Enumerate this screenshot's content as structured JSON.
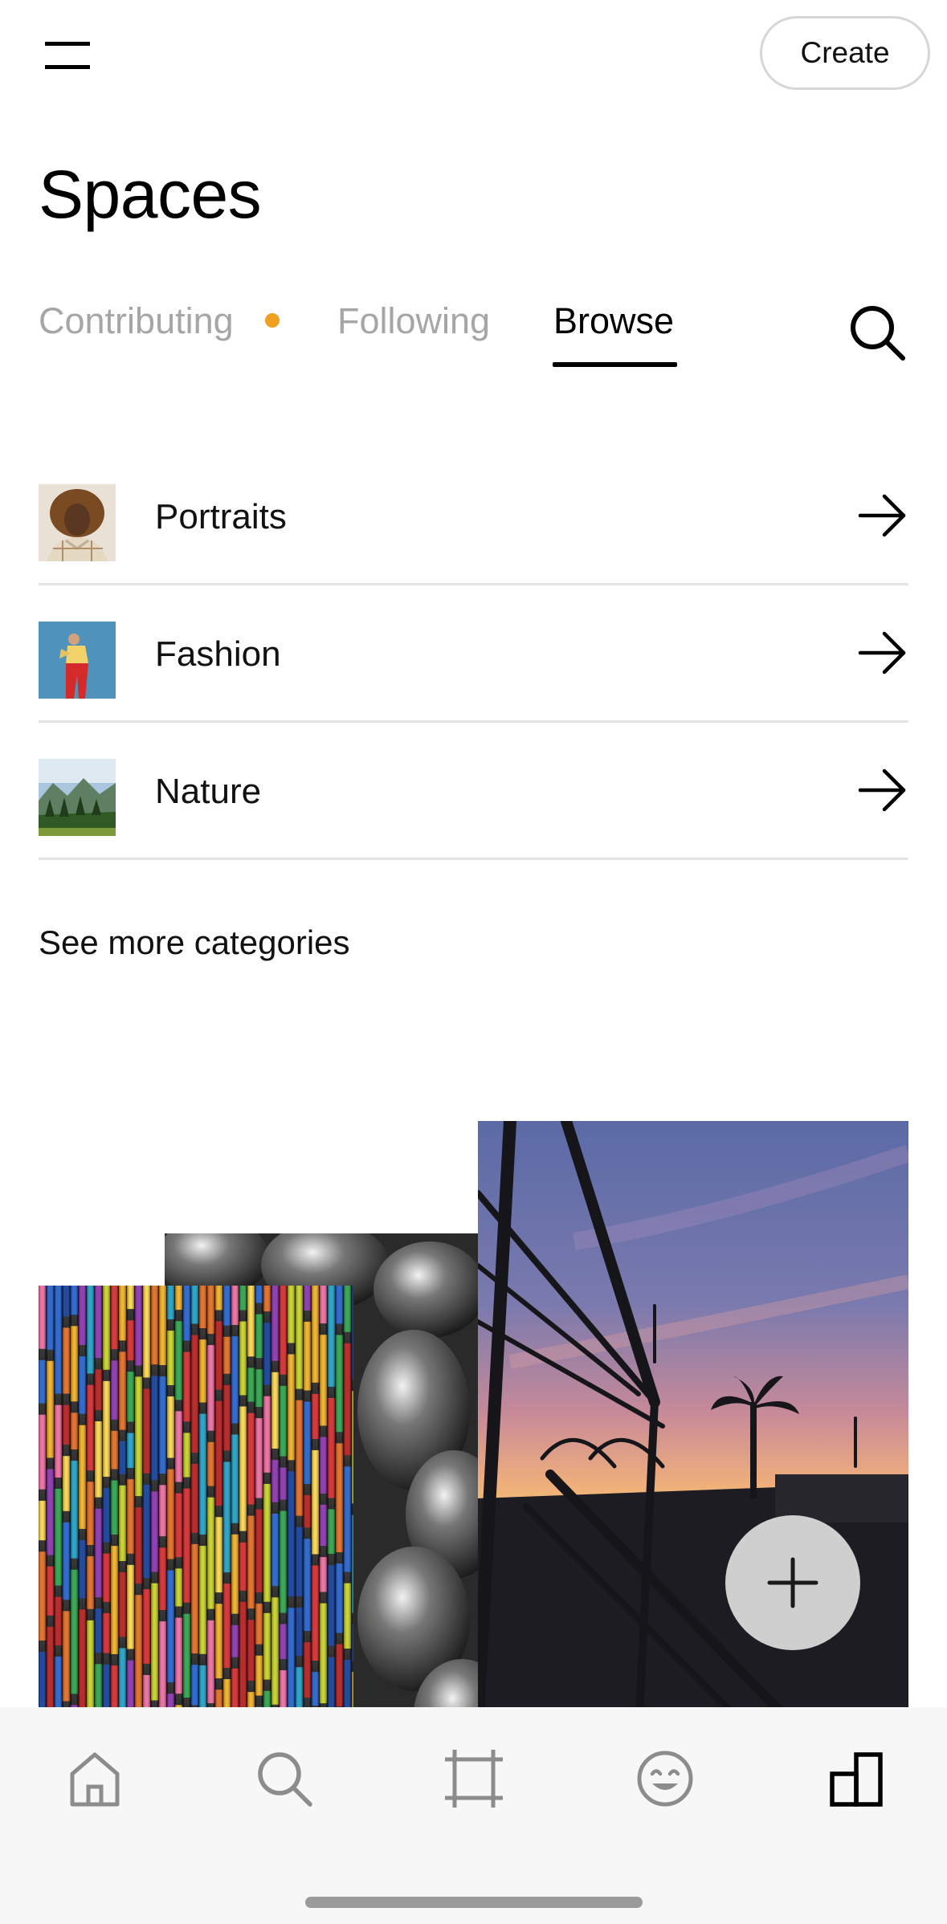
{
  "header": {
    "create_label": "Create",
    "menu_icon": "hamburger-menu-icon"
  },
  "page": {
    "title": "Spaces"
  },
  "tabs": [
    {
      "label": "Contributing",
      "has_dot": true,
      "dot_color": "#f0a020"
    },
    {
      "label": "Following"
    },
    {
      "label": "Browse",
      "active": true
    }
  ],
  "search_icon": "search-icon",
  "categories": [
    {
      "label": "Portraits",
      "icon": "arrow-right-icon"
    },
    {
      "label": "Fashion",
      "icon": "arrow-right-icon"
    },
    {
      "label": "Nature",
      "icon": "arrow-right-icon"
    }
  ],
  "see_more_label": "See more categories",
  "fab_icon": "plus-icon",
  "bottom_nav": [
    {
      "name": "home",
      "icon": "home-icon"
    },
    {
      "name": "search",
      "icon": "search-icon"
    },
    {
      "name": "crop",
      "icon": "crop-icon"
    },
    {
      "name": "smiley",
      "icon": "smiley-icon"
    },
    {
      "name": "spaces",
      "icon": "spaces-icon",
      "active": true
    }
  ],
  "colors": {
    "inactive_tab": "#a6a6a6",
    "accent_dot": "#f0a020",
    "nav_bg": "#f7f7f7",
    "fab_bg": "#cfcfcf"
  }
}
